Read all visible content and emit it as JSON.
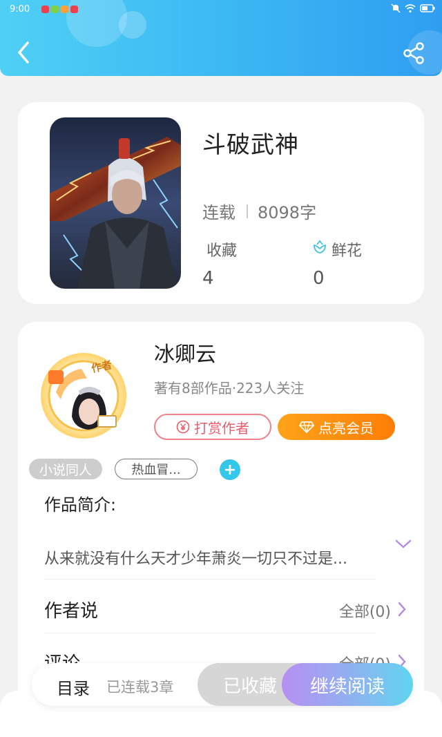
{
  "status_bar": {
    "time": "9:00"
  },
  "book": {
    "title": "斗破武神",
    "status": "连载",
    "word_count": "8098字",
    "favorites_label": "收藏",
    "favorites_count": "4",
    "flowers_label": "鲜花",
    "flowers_count": "0"
  },
  "author": {
    "name": "冰卿云",
    "badge": "作者",
    "meta": "著有8部作品·223人关注",
    "tip_label": "打赏作者",
    "vip_label": "点亮会员"
  },
  "tags": {
    "primary": "小说同人",
    "secondary": "热血冒...",
    "add": "+"
  },
  "intro": {
    "title": "作品简介:",
    "text": "从来就没有什么天才少年萧炎一切只不过是..."
  },
  "author_notes": {
    "title": "作者说",
    "more": "全部(0)"
  },
  "comments": {
    "title": "评论",
    "more": "全部(0)"
  },
  "bottom_bar": {
    "toc": "目录",
    "chapters": "已连载3章",
    "favorited": "已收藏",
    "continue": "继续阅读"
  },
  "colors": {
    "header_start": "#4fd0f5",
    "header_end": "#2f9ef1",
    "vip_orange": "#ff8a0d",
    "tip_red": "#ee5a6a",
    "accent_cyan": "#34c7ec",
    "accent_purple": "#b78ff2"
  }
}
